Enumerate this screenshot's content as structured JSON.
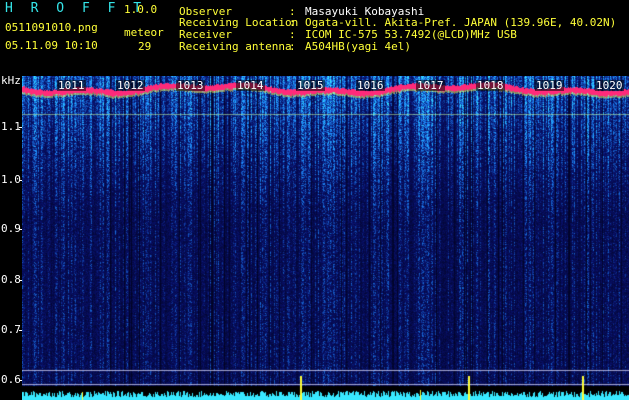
{
  "header": {
    "app_title": "H R O F F T",
    "app_version": "1.0.0",
    "filename": "0511091010.png",
    "datetime": "05.11.09 10:10",
    "meteor_label": "meteor",
    "meteor_count": "29"
  },
  "info": [
    {
      "label": "Observer",
      "value": "Masayuki Kobayashi"
    },
    {
      "label": "Receiving Location",
      "value": "Ogata-vill. Akita-Pref. JAPAN (139.96E, 40.02N)"
    },
    {
      "label": "Receiver",
      "value": "ICOM IC-575 53.7492(@LCD)MHz USB"
    },
    {
      "label": "Receiving antenna",
      "value": "A504HB(yagi 4el)"
    }
  ],
  "separator": ":",
  "axis": {
    "unit": "kHz",
    "y_ticks": [
      "1.1",
      "1.0",
      "0.9",
      "0.8",
      "0.7",
      "0.6"
    ],
    "x_ticks": [
      "1011",
      "1012",
      "1013",
      "1014",
      "1015",
      "1016",
      "1017",
      "1018",
      "1019",
      "1020"
    ]
  },
  "colors": {
    "background": "#000000",
    "label_cyan": "#35e6ea",
    "value_yellow": "#ffff38",
    "text_white": "#ffffff",
    "spectrogram_low": "#08106a",
    "spectrogram_mid": "#1e8cff",
    "spectrogram_high": "#38e8ff",
    "carrier_band": "#ff2a7a",
    "level_trace": "#38e8ff",
    "meteor_echo": "#ffff38"
  }
}
